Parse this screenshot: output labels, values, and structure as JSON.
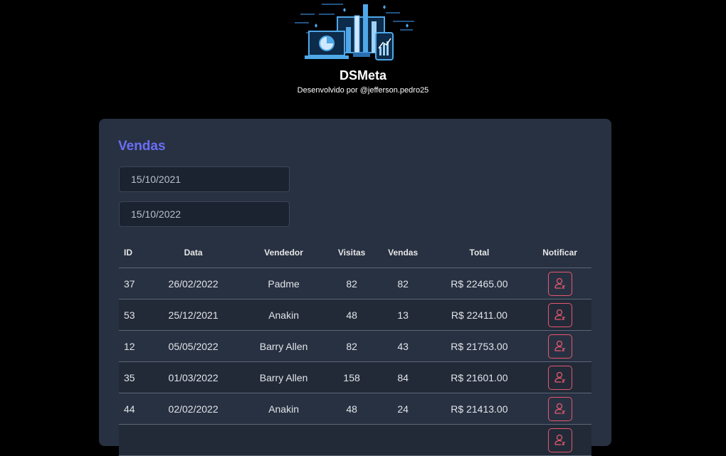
{
  "header": {
    "app_title": "DSMeta",
    "subtitle": "Desenvolvido por @jefferson.pedro25"
  },
  "card": {
    "title": "Vendas",
    "min_date": "15/10/2021",
    "max_date": "15/10/2022"
  },
  "table": {
    "columns": [
      "ID",
      "Data",
      "Vendedor",
      "Visitas",
      "Vendas",
      "Total",
      "Notificar"
    ],
    "rows": [
      {
        "id": "37",
        "date": "26/02/2022",
        "seller": "Padme",
        "visits": "82",
        "deals": "82",
        "total": "R$ 22465.00"
      },
      {
        "id": "53",
        "date": "25/12/2021",
        "seller": "Anakin",
        "visits": "48",
        "deals": "13",
        "total": "R$ 22411.00"
      },
      {
        "id": "12",
        "date": "05/05/2022",
        "seller": "Barry Allen",
        "visits": "82",
        "deals": "43",
        "total": "R$ 21753.00"
      },
      {
        "id": "35",
        "date": "01/03/2022",
        "seller": "Barry Allen",
        "visits": "158",
        "deals": "84",
        "total": "R$ 21601.00"
      },
      {
        "id": "44",
        "date": "02/02/2022",
        "seller": "Anakin",
        "visits": "48",
        "deals": "24",
        "total": "R$ 21413.00"
      },
      {
        "id": "",
        "date": "",
        "seller": "",
        "visits": "",
        "deals": "",
        "total": ""
      }
    ]
  },
  "colors": {
    "background": "#000000",
    "card": "#283142",
    "accent": "#6a6ef5",
    "notify": "#e5596d",
    "logo": "#4fa8e8"
  },
  "icons": {
    "logo": "dashboard-illustration-icon",
    "notify": "user-notify-icon"
  }
}
